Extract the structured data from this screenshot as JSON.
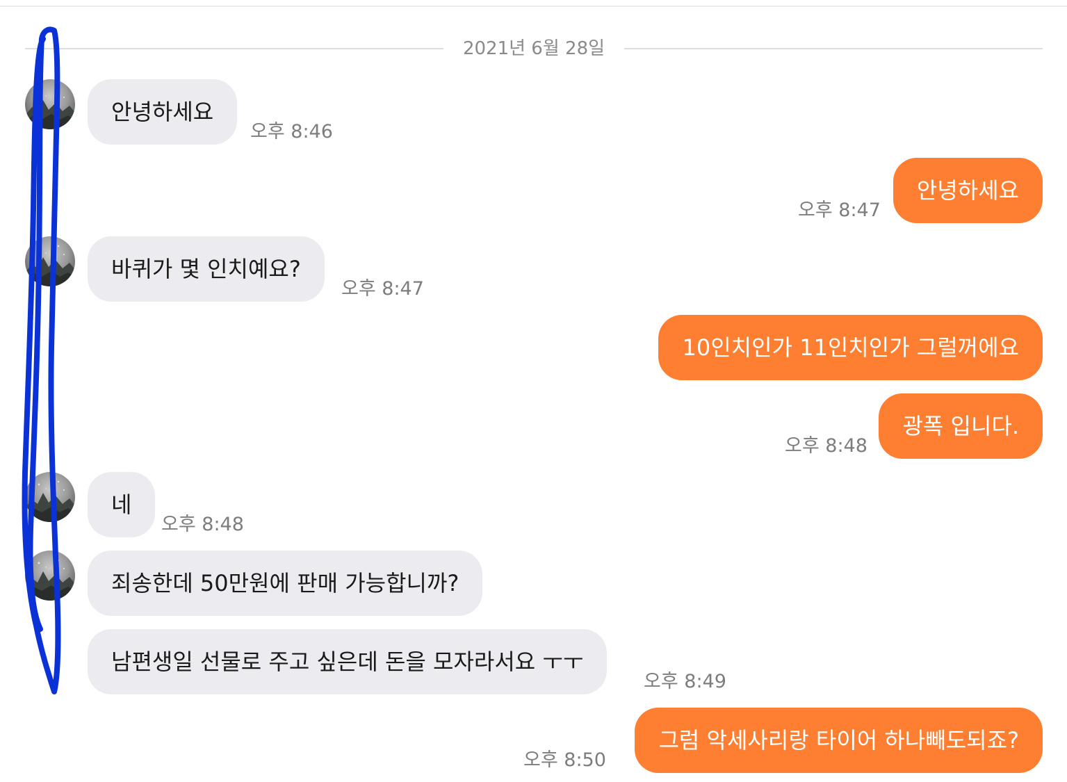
{
  "chat": {
    "date_separator": "2021년 6월 28일",
    "messages": [
      {
        "text": "안녕하세요",
        "time": "오후 8:46"
      },
      {
        "text": "안녕하세요",
        "time": "오후 8:47"
      },
      {
        "text": "바퀴가 몇 인치예요?",
        "time": "오후 8:47"
      },
      {
        "text": "10인치인가 11인치인가 그럴꺼에요"
      },
      {
        "text": "광폭 입니다.",
        "time": "오후 8:48"
      },
      {
        "text": "네",
        "time": "오후 8:48"
      },
      {
        "text": "죄송한데 50만원에 판매 가능합니까?"
      },
      {
        "text": "남편생일 선물로 주고 싶은데 돈을 모자라서요 ㅜㅜ",
        "time": "오후 8:49"
      },
      {
        "text": "그럼 악세사리랑 타이어 하나빼도되죠?",
        "time": "오후 8:50"
      }
    ]
  },
  "colors": {
    "outgoing_bubble": "#ff7f32",
    "incoming_bubble": "#ececf0",
    "annotation_stroke": "#0b32d6"
  }
}
